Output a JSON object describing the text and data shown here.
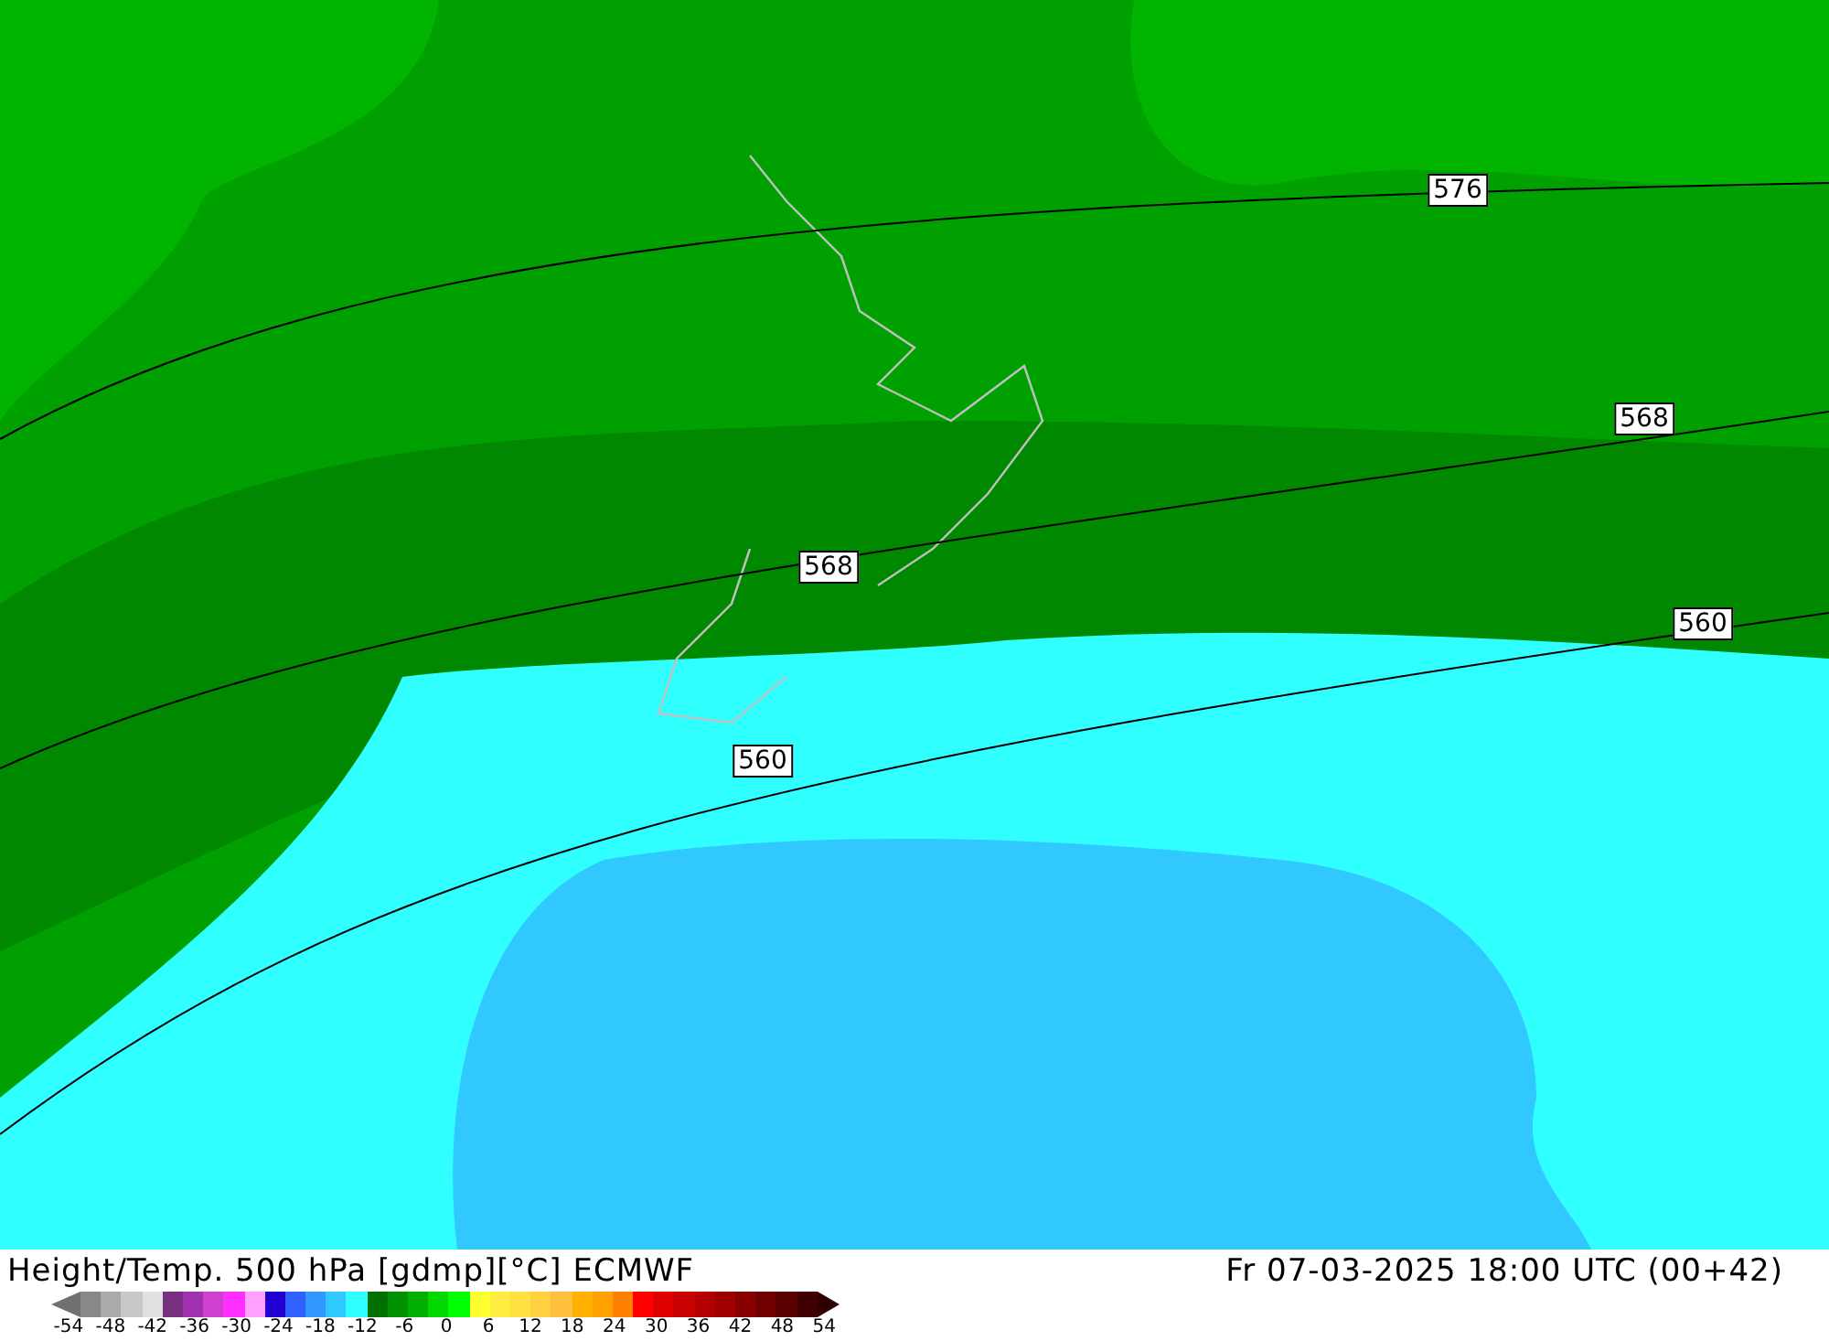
{
  "map": {
    "contour_labels": [
      "576",
      "568",
      "568",
      "560",
      "560"
    ]
  },
  "footer": {
    "title": "Height/Temp. 500 hPa [gdmp][°C] ECMWF",
    "datetime": "Fr 07-03-2025 18:00 UTC (00+42)"
  },
  "legend": {
    "swatches": [
      {
        "color": "#888888"
      },
      {
        "color": "#aaaaaa"
      },
      {
        "color": "#c8c8c8"
      },
      {
        "color": "#e0e0e0"
      },
      {
        "color": "#7a3080"
      },
      {
        "color": "#a030b0"
      },
      {
        "color": "#d040d0"
      },
      {
        "color": "#ff30ff"
      },
      {
        "color": "#ffa0ff"
      },
      {
        "color": "#2000d0"
      },
      {
        "color": "#3060ff"
      },
      {
        "color": "#3098ff"
      },
      {
        "color": "#30c8ff"
      },
      {
        "color": "#30ffff"
      },
      {
        "color": "#007000"
      },
      {
        "color": "#009000"
      },
      {
        "color": "#00b000"
      },
      {
        "color": "#00d800"
      },
      {
        "color": "#00ff00"
      },
      {
        "color": "#ffff30"
      },
      {
        "color": "#ffee40"
      },
      {
        "color": "#ffe040"
      },
      {
        "color": "#ffd040"
      },
      {
        "color": "#ffc040"
      },
      {
        "color": "#ffb000"
      },
      {
        "color": "#ffa000"
      },
      {
        "color": "#ff8000"
      },
      {
        "color": "#ff0000"
      },
      {
        "color": "#e00000"
      },
      {
        "color": "#c80000"
      },
      {
        "color": "#b40000"
      },
      {
        "color": "#a00000"
      },
      {
        "color": "#880000"
      },
      {
        "color": "#700000"
      },
      {
        "color": "#580000"
      },
      {
        "color": "#400000"
      }
    ],
    "ticks": [
      "-54",
      "-48",
      "-42",
      "-36",
      "-30",
      "-24",
      "-18",
      "-12",
      "-6",
      "0",
      "6",
      "12",
      "18",
      "24",
      "30",
      "36",
      "42",
      "48",
      "54"
    ]
  }
}
